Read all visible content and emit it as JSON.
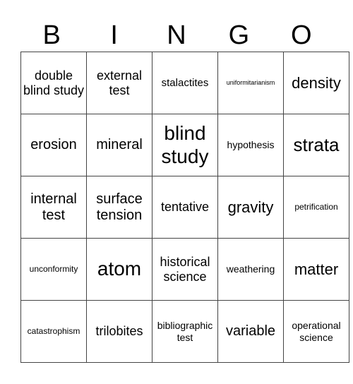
{
  "header": [
    "B",
    "I",
    "N",
    "G",
    "O"
  ],
  "grid": [
    [
      "double blind study",
      "external test",
      "stalactites",
      "uniformitarianism",
      "density"
    ],
    [
      "erosion",
      "mineral",
      "blind study",
      "hypothesis",
      "strata"
    ],
    [
      "internal test",
      "surface tension",
      "tentative",
      "gravity",
      "petrification"
    ],
    [
      "unconformity",
      "atom",
      "historical science",
      "weathering",
      "matter"
    ],
    [
      "catastrophism",
      "trilobites",
      "bibliographic test",
      "variable",
      "operational science"
    ]
  ]
}
